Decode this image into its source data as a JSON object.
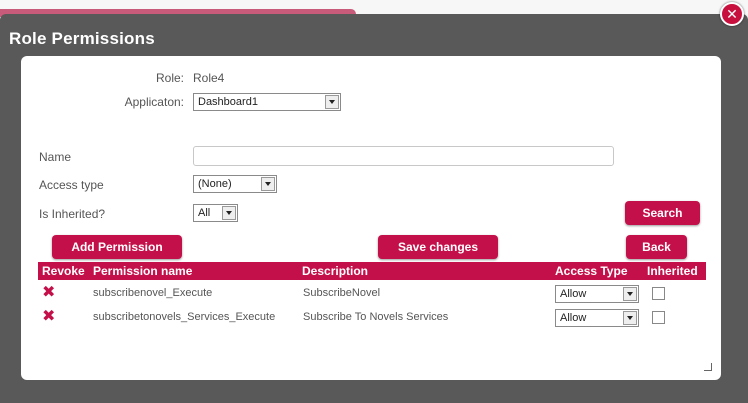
{
  "dialog": {
    "title": "Role Permissions",
    "close_icon": "close-icon (×)"
  },
  "form": {
    "role_label": "Role:",
    "role_value": "Role4",
    "application_label": "Applicaton:",
    "application_value": "Dashboard1",
    "name_label": "Name",
    "name_value": "",
    "access_type_label": "Access type",
    "access_type_value": "(None)",
    "inherited_label": "Is Inherited?",
    "inherited_value": "All"
  },
  "buttons": {
    "search": "Search",
    "add_permission": "Add Permission",
    "save_changes": "Save changes",
    "back": "Back"
  },
  "table": {
    "headers": [
      "Revoke",
      "Permission name",
      "Description",
      "Access Type",
      "Inherited"
    ],
    "rows": [
      {
        "permission": "subscribenovel_Execute",
        "description": "SubscribeNovel",
        "access": "Allow",
        "inherited": false
      },
      {
        "permission": "subscribetonovels_Services_Execute",
        "description": "Subscribe To Novels Services",
        "access": "Allow",
        "inherited": false
      }
    ]
  },
  "colors": {
    "accent": "#c4104a",
    "dialog_bg": "#595959",
    "panel_bg": "#ffffff"
  }
}
